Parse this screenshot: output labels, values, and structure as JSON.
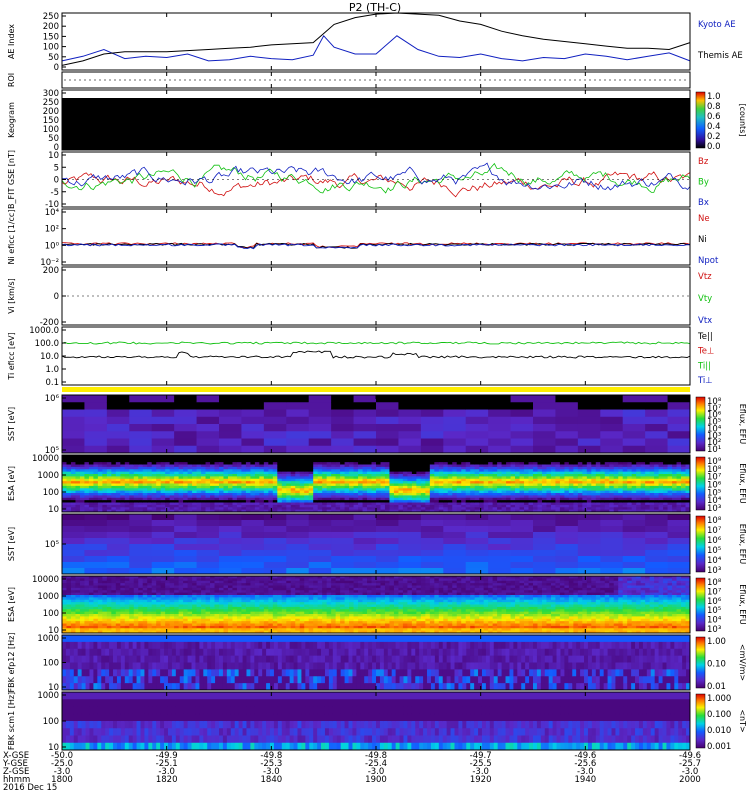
{
  "title": "P2 (TH-C)",
  "chart_data": [
    {
      "type": "line",
      "id": "ae",
      "ylabel": "AE Index",
      "ylim": [
        0,
        250
      ],
      "yticks": [
        "0",
        "50",
        "100",
        "150",
        "200",
        "250"
      ],
      "series": [
        {
          "name": "Kyoto AE",
          "color": "#1020c0",
          "x": [
            0,
            4,
            8,
            12,
            16,
            20,
            24,
            28,
            32,
            36,
            40,
            44,
            48,
            50,
            52,
            56,
            60,
            64,
            68,
            72,
            76,
            80,
            84,
            88,
            92,
            96,
            100,
            104,
            108,
            112,
            116,
            120
          ],
          "y": [
            40,
            60,
            90,
            50,
            60,
            55,
            70,
            40,
            45,
            60,
            50,
            45,
            65,
            150,
            100,
            70,
            70,
            150,
            90,
            60,
            55,
            70,
            50,
            40,
            55,
            50,
            70,
            60,
            45,
            60,
            75,
            40
          ]
        },
        {
          "name": "Themis AE",
          "color": "#000000",
          "x": [
            0,
            4,
            8,
            12,
            16,
            20,
            24,
            28,
            32,
            36,
            40,
            44,
            48,
            50,
            52,
            56,
            60,
            64,
            68,
            72,
            76,
            80,
            84,
            88,
            92,
            96,
            100,
            104,
            108,
            112,
            116,
            120
          ],
          "y": [
            20,
            40,
            70,
            80,
            80,
            80,
            85,
            90,
            95,
            100,
            110,
            115,
            120,
            160,
            200,
            230,
            245,
            250,
            245,
            240,
            215,
            200,
            170,
            150,
            135,
            125,
            115,
            105,
            95,
            95,
            90,
            120
          ]
        }
      ]
    },
    {
      "type": "line",
      "id": "roi",
      "ylabel": "ROI",
      "series": []
    },
    {
      "type": "heatmap",
      "id": "keogram",
      "ylabel": "Keogram",
      "ylim": [
        0,
        300
      ],
      "yticks": [
        "0",
        "50",
        "100",
        "150",
        "200",
        "250",
        "300"
      ],
      "colorbar": {
        "label": "[counts]",
        "ticks": [
          "0.0",
          "0.2",
          "0.4",
          "0.6",
          "0.8",
          "1.0"
        ]
      }
    },
    {
      "type": "line",
      "id": "bfield",
      "ylabel": "B_FIT GSE [nT]",
      "ylim": [
        -10,
        10
      ],
      "yticks": [
        "-10",
        "-5",
        "0",
        "5",
        "10"
      ],
      "series": [
        {
          "name": "Bz",
          "color": "#d01010"
        },
        {
          "name": "By",
          "color": "#10c010"
        },
        {
          "name": "Bx",
          "color": "#1020c0"
        }
      ]
    },
    {
      "type": "line",
      "id": "density",
      "ylabel": "Ni eficc [1/cc]",
      "yticks": [
        "10⁻²",
        "10⁰",
        "10²",
        "10⁴"
      ],
      "series": [
        {
          "name": "Ne",
          "color": "#d01010"
        },
        {
          "name": "Ni",
          "color": "#000000"
        },
        {
          "name": "Npot",
          "color": "#1020c0"
        }
      ]
    },
    {
      "type": "line",
      "id": "velocity",
      "ylabel": "Vi [km/s]",
      "yticks": [
        "-200",
        "0",
        "200"
      ],
      "series": [
        {
          "name": "Vtz",
          "color": "#d01010"
        },
        {
          "name": "Vty",
          "color": "#10c010"
        },
        {
          "name": "Vtx",
          "color": "#1020c0"
        }
      ]
    },
    {
      "type": "line",
      "id": "temperature",
      "ylabel": "Ti eficc [eV]",
      "yticks": [
        "0.1",
        "1.0",
        "10.0",
        "100.0",
        "1000.0"
      ],
      "series": [
        {
          "name": "Te||",
          "color": "#000000"
        },
        {
          "name": "Te⊥",
          "color": "#d01010"
        },
        {
          "name": "Ti||",
          "color": "#10c010"
        },
        {
          "name": "Ti⊥",
          "color": "#1020c0"
        }
      ]
    },
    {
      "type": "heatmap",
      "id": "sst-e",
      "ylabel": "SST [eV]",
      "yticks": [
        "10⁵",
        "10⁶"
      ],
      "colorbar": {
        "label": "Eflux, EFU",
        "ticks": [
          "10⁸",
          "10⁷",
          "10⁶",
          "10⁵",
          "10⁴",
          "10³",
          "10²",
          "10¹"
        ]
      }
    },
    {
      "type": "heatmap",
      "id": "esa-e",
      "ylabel": "ESA [eV]",
      "yticks": [
        "10",
        "100",
        "1000",
        "10000"
      ],
      "colorbar": {
        "label": "Eflux, EFU",
        "ticks": [
          "10⁹",
          "10⁸",
          "10⁷",
          "10⁶",
          "10⁵",
          "10⁴",
          "10³"
        ]
      }
    },
    {
      "type": "heatmap",
      "id": "sst-i",
      "ylabel": "SST [eV]",
      "yticks": [
        "10⁵"
      ],
      "colorbar": {
        "label": "Eflux, EFU",
        "ticks": [
          "10⁸",
          "10⁷",
          "10⁶",
          "10⁵",
          "10⁴",
          "10³"
        ]
      }
    },
    {
      "type": "heatmap",
      "id": "esa-i",
      "ylabel": "ESA [eV]",
      "yticks": [
        "10",
        "100",
        "1000",
        "10000"
      ],
      "colorbar": {
        "label": "Eflux, EFU",
        "ticks": [
          "10⁸",
          "10⁷",
          "10⁶",
          "10⁵",
          "10⁴",
          "10³"
        ]
      }
    },
    {
      "type": "heatmap",
      "id": "fbk-e",
      "ylabel": "FBK efp12 [Hz]",
      "yticks": [
        "10",
        "100",
        "1000"
      ],
      "colorbar": {
        "label": "<mV/m>",
        "ticks": [
          "1.00",
          "0.10",
          "0.01"
        ]
      }
    },
    {
      "type": "heatmap",
      "id": "fbk-b",
      "ylabel": "FBK scm1 [Hz]",
      "yticks": [
        "10",
        "100",
        "1000"
      ],
      "colorbar": {
        "label": "<nT>",
        "ticks": [
          "1.000",
          "0.100",
          "0.010",
          "0.001"
        ]
      }
    }
  ],
  "footer": {
    "row_labels": [
      "X-GSE",
      "Y-GSE",
      "Z-GSE",
      "hhmm",
      "2016 Dec 15"
    ],
    "columns": [
      [
        "-50.0",
        "-25.0",
        "-3.0",
        "1800"
      ],
      [
        "-49.9",
        "-25.1",
        "-3.0",
        "1820"
      ],
      [
        "-49.8",
        "-25.3",
        "-3.0",
        "1840"
      ],
      [
        "-49.8",
        "-25.4",
        "-3.0",
        "1900"
      ],
      [
        "-49.7",
        "-25.5",
        "-3.0",
        "1920"
      ],
      [
        "-49.6",
        "-25.6",
        "-3.0",
        "1940"
      ],
      [
        "-49.6",
        "-25.7",
        "-3.0",
        "2000"
      ]
    ]
  }
}
